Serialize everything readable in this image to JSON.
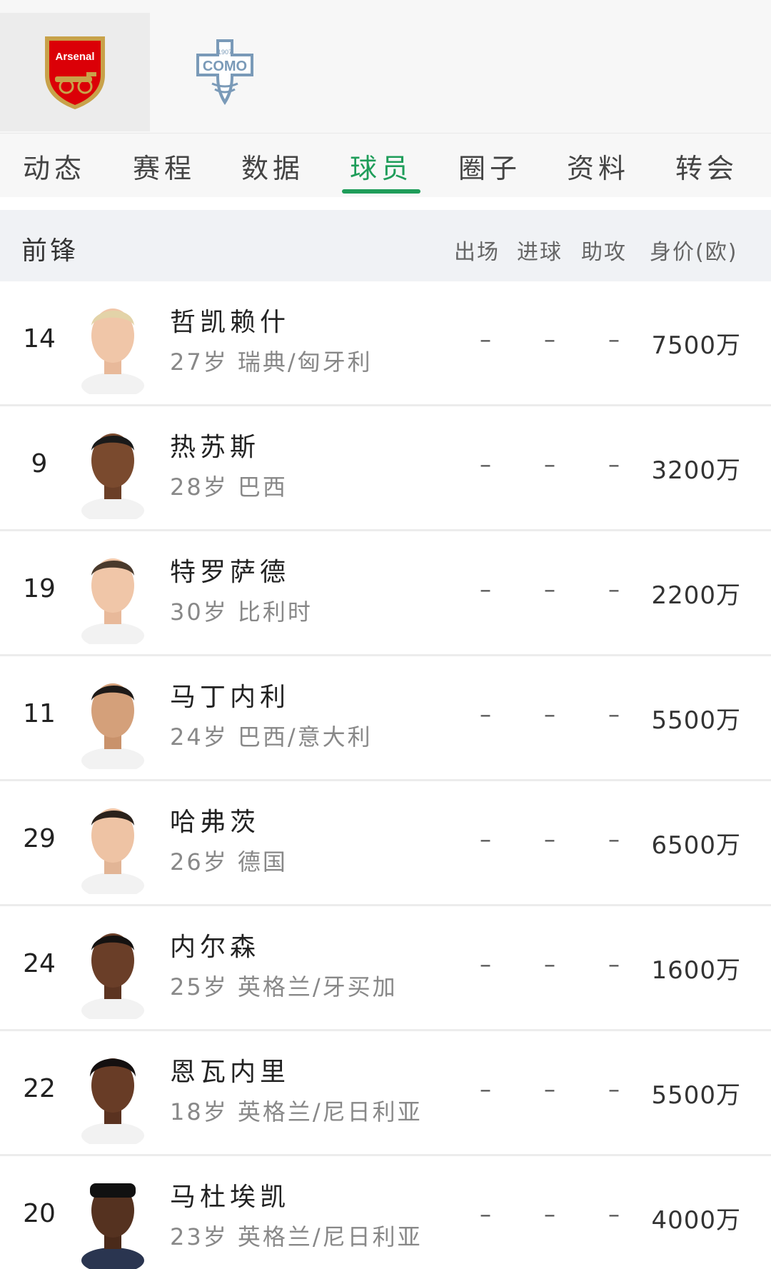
{
  "teams": [
    {
      "name": "Arsenal",
      "colors": {
        "primary": "#db0007",
        "secondary": "#ffffff",
        "gold": "#c8a24a"
      }
    },
    {
      "name": "COMO",
      "year": "1907",
      "colors": {
        "primary": "#7a9ab8",
        "secondary": "#ffffff"
      }
    }
  ],
  "tabs": [
    {
      "label": "动态"
    },
    {
      "label": "赛程"
    },
    {
      "label": "数据"
    },
    {
      "label": "球员",
      "active": true
    },
    {
      "label": "圈子"
    },
    {
      "label": "资料"
    },
    {
      "label": "转会"
    }
  ],
  "section": {
    "title": "前锋",
    "columns": {
      "appearances": "出场",
      "goals": "进球",
      "assists": "助攻",
      "value": "身价(欧)"
    }
  },
  "players": [
    {
      "number": "14",
      "name": "哲凯赖什",
      "info": "27岁 瑞典/匈牙利",
      "appearances": "–",
      "goals": "–",
      "assists": "–",
      "value": "7500万"
    },
    {
      "number": "9",
      "name": "热苏斯",
      "info": "28岁 巴西",
      "appearances": "–",
      "goals": "–",
      "assists": "–",
      "value": "3200万"
    },
    {
      "number": "19",
      "name": "特罗萨德",
      "info": "30岁 比利时",
      "appearances": "–",
      "goals": "–",
      "assists": "–",
      "value": "2200万"
    },
    {
      "number": "11",
      "name": "马丁内利",
      "info": "24岁 巴西/意大利",
      "appearances": "–",
      "goals": "–",
      "assists": "–",
      "value": "5500万"
    },
    {
      "number": "29",
      "name": "哈弗茨",
      "info": "26岁 德国",
      "appearances": "–",
      "goals": "–",
      "assists": "–",
      "value": "6500万"
    },
    {
      "number": "24",
      "name": "内尔森",
      "info": "25岁 英格兰/牙买加",
      "appearances": "–",
      "goals": "–",
      "assists": "–",
      "value": "1600万"
    },
    {
      "number": "22",
      "name": "恩瓦内里",
      "info": "18岁 英格兰/尼日利亚",
      "appearances": "–",
      "goals": "–",
      "assists": "–",
      "value": "5500万"
    },
    {
      "number": "20",
      "name": "马杜埃凯",
      "info": "23岁 英格兰/尼日利亚",
      "appearances": "–",
      "goals": "–",
      "assists": "–",
      "value": "4000万"
    }
  ],
  "accent_color": "#1f9d5a"
}
